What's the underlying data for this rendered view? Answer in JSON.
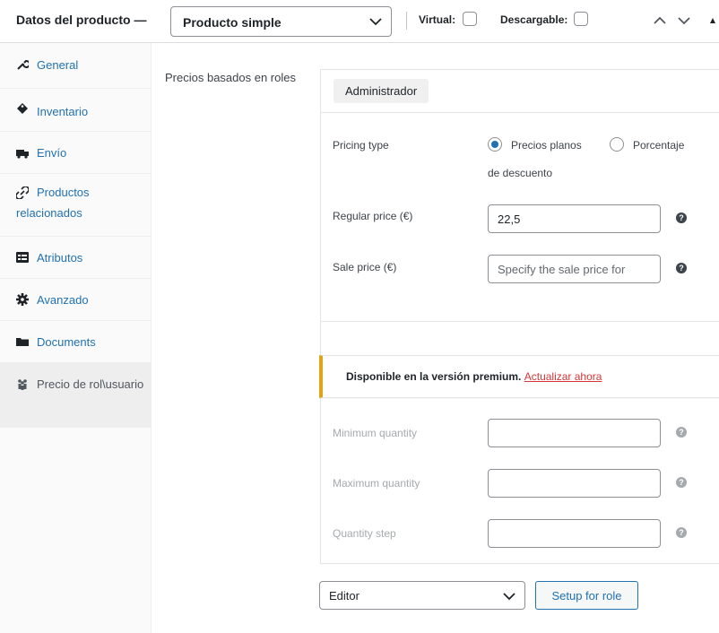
{
  "header": {
    "title": "Datos del producto —",
    "product_type": "Producto simple",
    "virtual_label": "Virtual:",
    "downloadable_label": "Descargable:"
  },
  "sidebar": {
    "items": [
      {
        "label": "General",
        "icon": "wrench-icon"
      },
      {
        "label": "Inventario",
        "icon": "tag-icon"
      },
      {
        "label": "Envío",
        "icon": "truck-icon"
      },
      {
        "label": "Productos relacionados",
        "icon": "link-icon"
      },
      {
        "label": "Atributos",
        "icon": "list-icon"
      },
      {
        "label": "Avanzado",
        "icon": "gear-icon"
      },
      {
        "label": "Documents",
        "icon": "folder-icon"
      },
      {
        "label": "Precio de rol\\usuario",
        "icon": "users-icon",
        "active": true
      }
    ]
  },
  "main": {
    "field_label": "Precios basados en roles",
    "role_tag": "Administrador",
    "pricing_type_label": "Pricing type",
    "pricing_options": [
      "Precios planos",
      "Porcentaje de descuento"
    ],
    "regular_price_label": "Regular price (€)",
    "regular_price_value": "22,5",
    "sale_price_label": "Sale price (€)",
    "sale_price_placeholder": "Specify the sale price for",
    "notice_text": "Disponible en la versión premium.",
    "notice_link": "Actualizar ahora",
    "min_qty_label": "Minimum quantity",
    "max_qty_label": "Maximum quantity",
    "qty_step_label": "Quantity step",
    "role_select_value": "Editor",
    "setup_button": "Setup for role"
  },
  "colors": {
    "link": "#2271b1",
    "notice_border": "#dba617",
    "notice_link": "#d63638"
  }
}
